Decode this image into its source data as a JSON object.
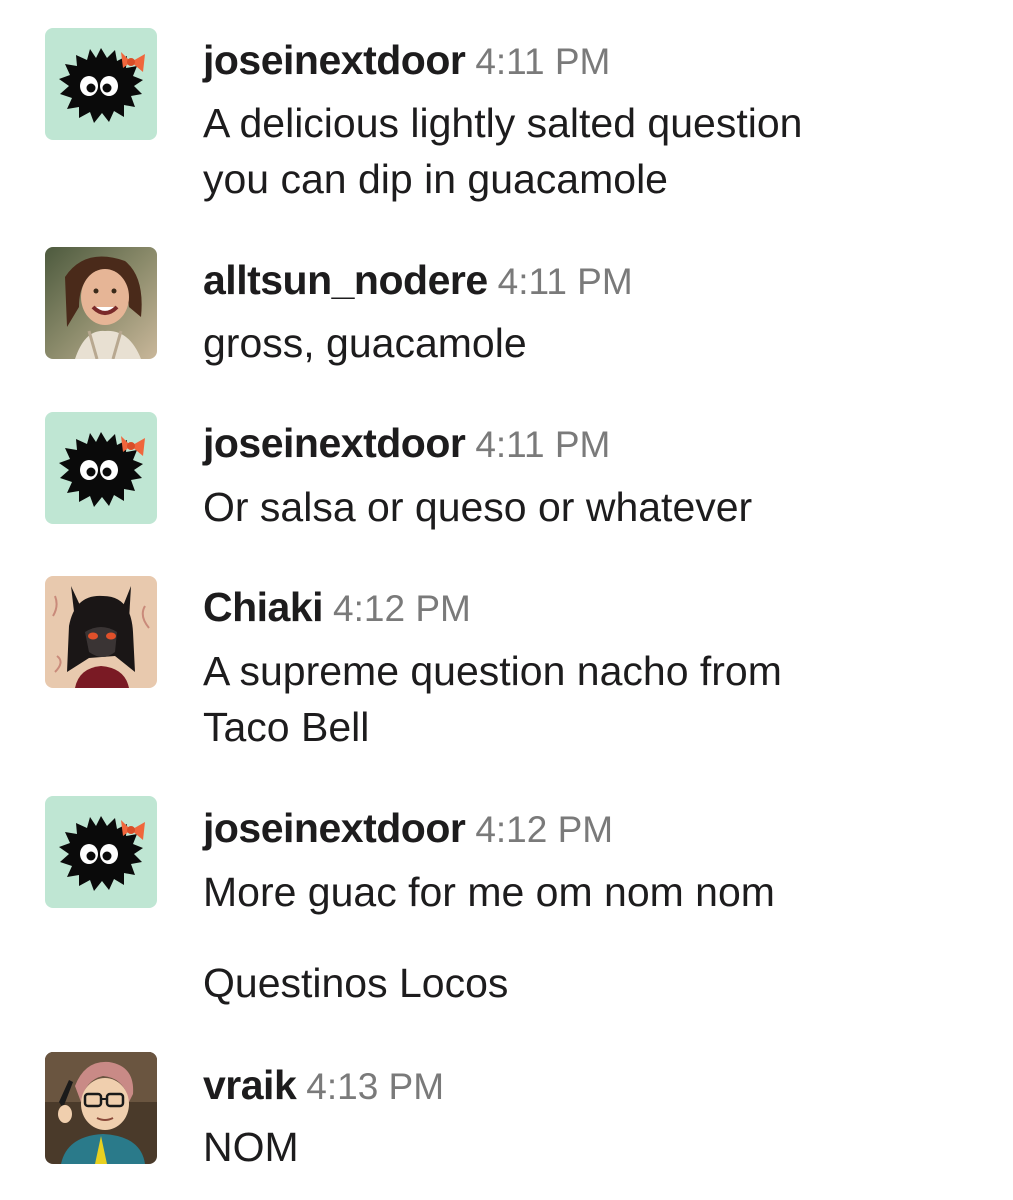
{
  "messages": [
    {
      "author": "joseinextdoor",
      "time": "4:11 PM",
      "lines": [
        "A delicious lightly salted question",
        "you can dip in guacamole"
      ]
    },
    {
      "author": "alltsun_nodere",
      "time": "4:11 PM",
      "lines": [
        "gross, guacamole"
      ]
    },
    {
      "author": "joseinextdoor",
      "time": "4:11 PM",
      "lines": [
        "Or salsa or queso or whatever"
      ]
    },
    {
      "author": "Chiaki",
      "time": "4:12 PM",
      "lines": [
        "A supreme question nacho from",
        "Taco Bell"
      ]
    },
    {
      "author": "joseinextdoor",
      "time": "4:12 PM",
      "lines": [
        "More guac for me om nom nom"
      ]
    },
    {
      "lines": [
        "Questinos Locos"
      ]
    },
    {
      "author": "vraik",
      "time": "4:13 PM",
      "lines": [
        "NOM"
      ]
    }
  ],
  "colors": {
    "soot_avatar_bg": "#bfe6d3",
    "bow": "#f0663c",
    "timestamp": "#7a7a7a",
    "text": "#1d1c1d"
  },
  "icons": {
    "joseinextdoor": "soot-sprite-with-bow-avatar",
    "alltsun_nodere": "photo-avatar",
    "Chiaki": "illustrated-character-avatar",
    "vraik": "illustrated-person-with-glasses-avatar"
  }
}
